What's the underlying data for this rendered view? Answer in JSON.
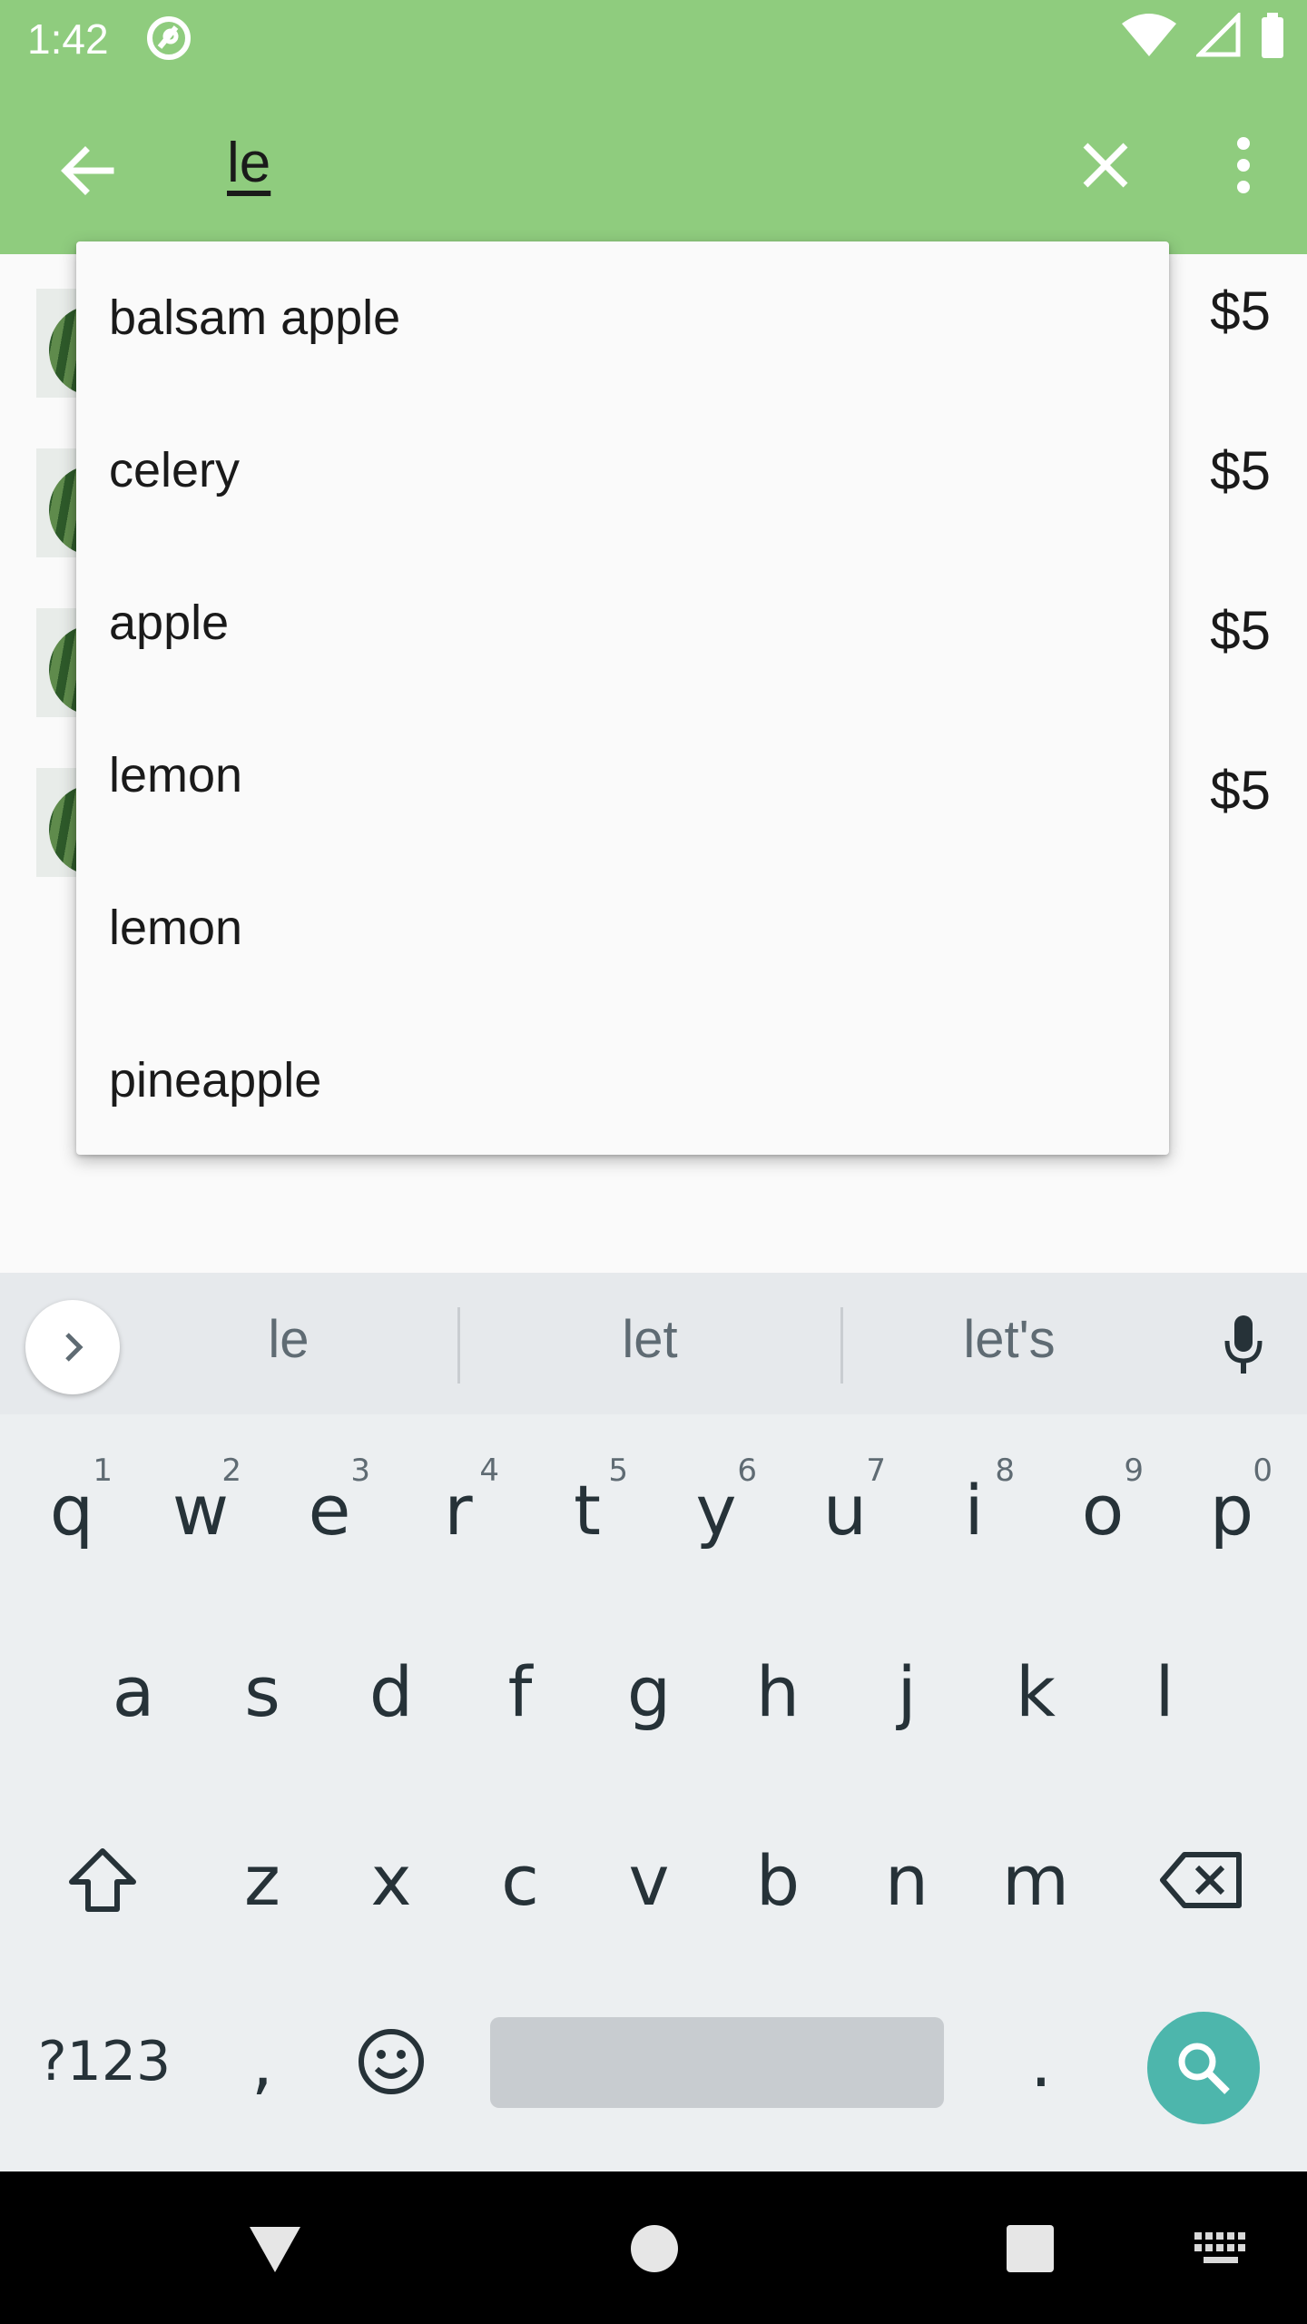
{
  "status_bar": {
    "time": "1:42"
  },
  "search": {
    "query": "le"
  },
  "list": {
    "items": [
      {
        "price": "$5"
      },
      {
        "price": "$5"
      },
      {
        "price": "$5"
      },
      {
        "price": "$5"
      }
    ]
  },
  "suggestions": [
    "balsam apple",
    "celery",
    "apple",
    "lemon",
    "lemon",
    "pineapple"
  ],
  "keyboard": {
    "suggested_words": [
      "le",
      "let",
      "let's"
    ],
    "row1": [
      {
        "key": "q",
        "hint": "1"
      },
      {
        "key": "w",
        "hint": "2"
      },
      {
        "key": "e",
        "hint": "3"
      },
      {
        "key": "r",
        "hint": "4"
      },
      {
        "key": "t",
        "hint": "5"
      },
      {
        "key": "y",
        "hint": "6"
      },
      {
        "key": "u",
        "hint": "7"
      },
      {
        "key": "i",
        "hint": "8"
      },
      {
        "key": "o",
        "hint": "9"
      },
      {
        "key": "p",
        "hint": "0"
      }
    ],
    "row2": [
      "a",
      "s",
      "d",
      "f",
      "g",
      "h",
      "j",
      "k",
      "l"
    ],
    "row3": [
      "z",
      "x",
      "c",
      "v",
      "b",
      "n",
      "m"
    ],
    "symbols_label": "?123",
    "comma": ",",
    "period": "."
  },
  "colors": {
    "app_bar": "#8fcc7e",
    "search_key": "#4db6ac",
    "keyboard_bg": "#eceff1"
  }
}
